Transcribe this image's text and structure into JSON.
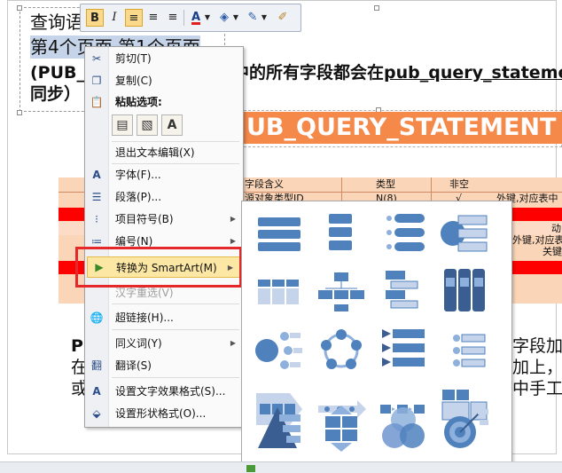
{
  "slide": {
    "title_line1": "查询语句类",
    "title_line2": "第4个页面 第1个页面",
    "bold_line1a": "(PUB_Q",
    "bold_line1b": "中的所有字段都会在",
    "bold_line1c": "pub_query_statemen",
    "bold_line2": "同步）",
    "banner_text": "UB_QUERY_STATEMENT",
    "table_headers": [
      "字段含义",
      "类型",
      "非空"
    ],
    "table_row_cells": [
      "源对象类型ID",
      "N(8)",
      "√",
      "外键,对应表中"
    ],
    "right_cells": [
      "动",
      "外键,对应表",
      "关键"
    ],
    "body_line1a": "Pu",
    "body_line1b": "字段加",
    "body_line2a": "在",
    "body_line2b": "加上，",
    "body_line3a": "或",
    "body_line3b": "中手工"
  },
  "mini_toolbar": {
    "bold": "B",
    "italic": "I",
    "font_color_letter": "A"
  },
  "context_menu": {
    "items": [
      {
        "label": "剪切(T)",
        "icon": "scissors-icon"
      },
      {
        "label": "复制(C)",
        "icon": "copy-icon"
      },
      {
        "label": "粘贴选项:",
        "icon": "paste-icon"
      },
      {
        "label": "退出文本编辑(X)",
        "icon": ""
      },
      {
        "label": "字体(F)...",
        "icon": "font-icon"
      },
      {
        "label": "段落(P)...",
        "icon": "paragraph-icon"
      },
      {
        "label": "项目符号(B)",
        "icon": "bullets-icon"
      },
      {
        "label": "编号(N)",
        "icon": "numbering-icon"
      },
      {
        "label": "转换为 SmartArt(M)",
        "icon": "smartart-icon"
      },
      {
        "label": "汉字重选(V)",
        "icon": ""
      },
      {
        "label": "超链接(H)...",
        "icon": "hyperlink-icon"
      },
      {
        "label": "同义词(Y)",
        "icon": ""
      },
      {
        "label": "翻译(S)",
        "icon": "translate-icon"
      },
      {
        "label": "设置文字效果格式(S)...",
        "icon": "text-effects-icon"
      },
      {
        "label": "设置形状格式(O)...",
        "icon": "shape-format-icon"
      }
    ],
    "paste_option_letter": "A"
  },
  "colors": {
    "banner": "#f5894a",
    "table_red": "#ff0000",
    "table_peach": "#fbd5b8",
    "highlight_border": "#e5282a",
    "menu_hover": "#fce8a4",
    "smartart_blue": "#4f81bd"
  }
}
